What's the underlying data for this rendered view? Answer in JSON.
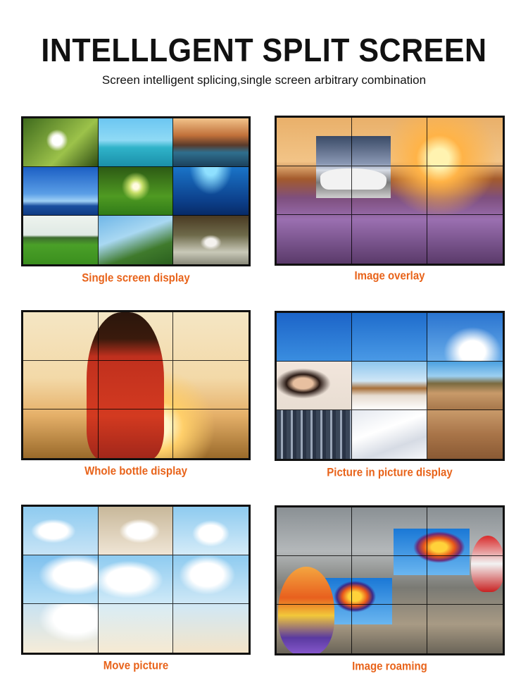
{
  "header": {
    "title": "INTELLLGENT SPLIT SCREEN",
    "subtitle": "Screen intelligent splicing,single screen arbitrary combination"
  },
  "panels": [
    {
      "caption": "Single screen display"
    },
    {
      "caption": "Image overlay"
    },
    {
      "caption": "Whole bottle display"
    },
    {
      "caption": "Picture in picture display"
    },
    {
      "caption": "Move picture"
    },
    {
      "caption": "Image roaming"
    }
  ],
  "colors": {
    "caption": "#e8631a",
    "title": "#111111",
    "frame": "#111111"
  }
}
